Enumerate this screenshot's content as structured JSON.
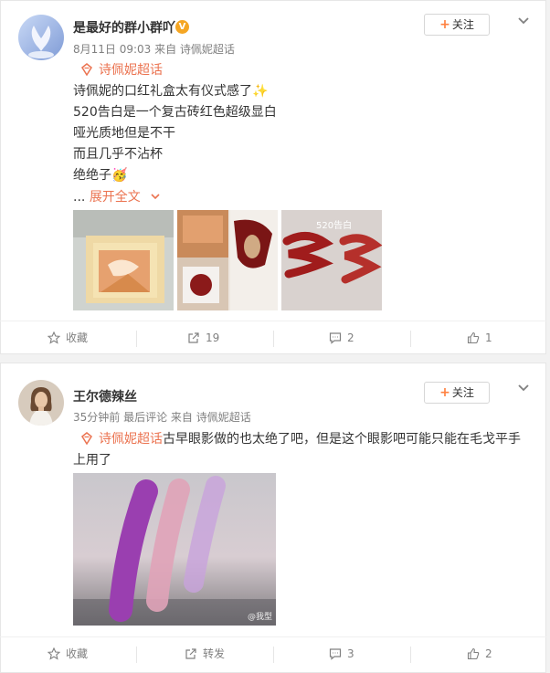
{
  "posts": [
    {
      "author": "是最好的群小群吖",
      "verified_badge": "V",
      "meta": "8月11日 09:03 来自 诗佩妮超话",
      "follow_label": "关注",
      "topic": "诗佩妮超话",
      "lines": [
        "诗佩妮的口红礼盒太有仪式感了✨",
        "520告白是一个复古砖红色超级显白",
        "哑光质地但是不干",
        "而且几乎不沾杯",
        "绝绝子🥳"
      ],
      "expand_prefix": "...",
      "expand_label": "展开全文",
      "photo3_caption": "520告白",
      "actions": {
        "favorite": "收藏",
        "repost": "19",
        "comment": "2",
        "like": "1"
      }
    },
    {
      "author": "王尔德辣丝",
      "meta": "35分钟前 最后评论 来自 诗佩妮超话",
      "follow_label": "关注",
      "topic": "诗佩妮超话",
      "text_line1": "古早眼影做的也太绝了吧，但是这个眼影吧可能只能在毛戈平手",
      "text_line2": "上用了",
      "watermark": "@我型",
      "actions": {
        "favorite": "收藏",
        "repost": "转发",
        "comment": "3",
        "like": "2"
      }
    }
  ],
  "colors": {
    "accent": "#eb7350",
    "follow_plus": "#ff8140",
    "verified": "#f5a623",
    "text_secondary": "#808080"
  },
  "icons": [
    "star-icon",
    "repost-icon",
    "comment-icon",
    "like-icon",
    "chevron-down-icon",
    "supertopic-icon"
  ]
}
